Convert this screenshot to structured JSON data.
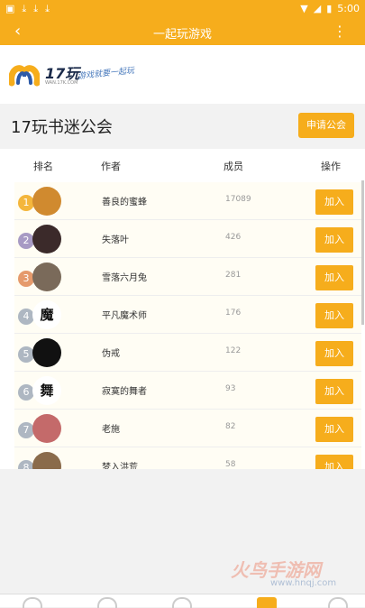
{
  "statusbar": {
    "time": "5:00",
    "left_icons": [
      "image-icon",
      "download-icon",
      "download-icon",
      "download-icon"
    ],
    "right_icons": [
      "wifi-icon",
      "signal-icon",
      "battery-icon"
    ]
  },
  "appbar": {
    "title": "一起玩游戏",
    "back": "‹",
    "more": "⋮"
  },
  "brand": {
    "logo_text": "17玩",
    "url": "WAN.17K.COM",
    "slogan": "游戏就要一起玩"
  },
  "guild": {
    "title": "17玩书迷公会",
    "apply_button": "申请公会"
  },
  "table": {
    "headers": {
      "rank": "排名",
      "author": "作者",
      "members": "成员",
      "action": "操作"
    },
    "rows": [
      {
        "rank": "1",
        "author": "善良的蜜蜂",
        "members": "17089",
        "action": "加入",
        "avatar": "book-logo",
        "rank_color": "#f4b63c",
        "avatar_color": "#d08a2f"
      },
      {
        "rank": "2",
        "author": "失落叶",
        "members": "426",
        "action": "加入",
        "avatar": "dark-photo",
        "rank_color": "#a79ac4",
        "avatar_color": "#3b2a2a"
      },
      {
        "rank": "3",
        "author": "雪落六月兔",
        "members": "281",
        "action": "加入",
        "avatar": "cartoon",
        "rank_color": "#e59a6c",
        "avatar_color": "#7a6a5a"
      },
      {
        "rank": "4",
        "author": "平凡魔术师",
        "members": "176",
        "action": "加入",
        "avatar": "魔",
        "rank_color": "#aeb7c2",
        "avatar_color": "#ffffff"
      },
      {
        "rank": "5",
        "author": "伪戒",
        "members": "122",
        "action": "加入",
        "avatar": "dark-photo",
        "rank_color": "#aeb7c2",
        "avatar_color": "#111111"
      },
      {
        "rank": "6",
        "author": "寂寞的舞者",
        "members": "93",
        "action": "加入",
        "avatar": "舞",
        "rank_color": "#aeb7c2",
        "avatar_color": "#ffffff"
      },
      {
        "rank": "7",
        "author": "老施",
        "members": "82",
        "action": "加入",
        "avatar": "red-photo",
        "rank_color": "#aeb7c2",
        "avatar_color": "#c46a6a"
      },
      {
        "rank": "8",
        "author": "梦入洪荒",
        "members": "58",
        "action": "加入",
        "avatar": "painting",
        "rank_color": "#aeb7c2",
        "avatar_color": "#8a6b4b"
      }
    ]
  },
  "watermark": {
    "text": "火鸟手游网",
    "url": "www.hnqj.com"
  },
  "colors": {
    "accent": "#f6ad1c",
    "background": "#f2f2f2"
  }
}
